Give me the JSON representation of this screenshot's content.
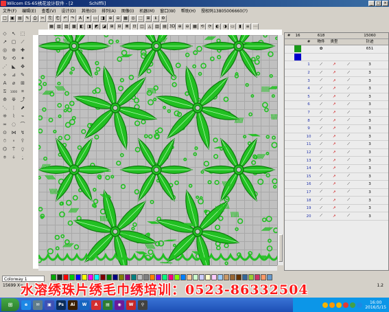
{
  "window": {
    "title": "Wilcom ES-65绣花设计软件 - [2",
    "doc": "Schiffli]",
    "buttons": [
      "_",
      "□",
      "×"
    ]
  },
  "menu": [
    "文件(F)",
    "编辑(E)",
    "查看(V)",
    "设计(D)",
    "其他(O)",
    "排列(A)",
    "图像(I)",
    "机器(M)",
    "窗口(W)",
    "帮助(H)",
    "授权码13805006660(?)"
  ],
  "toolbar1": [
    "□",
    "▣",
    "▤",
    "✎",
    "⎙",
    "✂",
    "⎘",
    "⎗",
    "↶",
    "↷",
    "A",
    "✦",
    "▭",
    "◨",
    "⊕",
    "⊖",
    "▦",
    "◎",
    "⬚",
    "⊞",
    "ℹ",
    "⚙"
  ],
  "toolbar2": [
    "▦",
    "▧",
    "▨",
    "▩",
    "◧",
    "◨",
    "◩",
    "◪",
    "⊞",
    "⊟",
    "⊠",
    "⊡",
    "◫",
    "◬",
    "▥",
    "▤",
    "3D",
    "⊕",
    "⊖",
    "▦",
    "⟲",
    "⟳",
    "◐",
    "◑",
    "▭",
    "▮",
    "≡",
    "⋯"
  ],
  "lefttools": [
    "◇",
    "↖",
    "⬚",
    "↗",
    "▢",
    "⟋",
    "◎",
    "⊕",
    "✚",
    "↻",
    "⟲",
    "✦",
    "⋰",
    "◣",
    "✥",
    "⟡",
    "⊿",
    "✎",
    "A",
    "⌀",
    "⊞",
    "⍂",
    "1000",
    "⌗",
    "⟰",
    "⟱",
    "⤴",
    "⋱",
    "⋮",
    "⬈",
    "⁜",
    "⌇",
    "⌁",
    "∞",
    "◌",
    "⌒",
    "⊙",
    "⋈",
    "↯",
    "⍥",
    "⍤",
    "⍢",
    "⌬",
    "⍡",
    "⍜",
    "⍟",
    "⍭",
    "⍮"
  ],
  "panel": {
    "header": [
      "#",
      "16",
      "",
      "618",
      "",
      "15060"
    ],
    "header2": [
      "",
      "",
      "#",
      "物件",
      "类型",
      "",
      "针迹"
    ],
    "rows": [
      {
        "n": "",
        "color": "#1a9a1a",
        "a": "✿",
        "b": "",
        "c": "",
        "d": "651"
      },
      {
        "n": "",
        "color": "#0000cc",
        "a": "",
        "b": "",
        "c": "",
        "d": ""
      },
      {
        "n": "1",
        "color": "",
        "a": "⟋",
        "b": "↗",
        "c": "⟋",
        "d": "3"
      },
      {
        "n": "2",
        "color": "",
        "a": "⟋",
        "b": "↗",
        "c": "⟋",
        "d": "3"
      },
      {
        "n": "3",
        "color": "",
        "a": "⟋",
        "b": "↗",
        "c": "⟋",
        "d": "3"
      },
      {
        "n": "4",
        "color": "",
        "a": "⟋",
        "b": "↗",
        "c": "⟋",
        "d": "3"
      },
      {
        "n": "5",
        "color": "",
        "a": "⟋",
        "b": "↗",
        "c": "⟋",
        "d": "3"
      },
      {
        "n": "6",
        "color": "",
        "a": "⟋",
        "b": "↗",
        "c": "⟋",
        "d": "3"
      },
      {
        "n": "7",
        "color": "",
        "a": "⟋",
        "b": "↗",
        "c": "⟋",
        "d": "3"
      },
      {
        "n": "8",
        "color": "",
        "a": "⟋",
        "b": "↗",
        "c": "⟋",
        "d": "3"
      },
      {
        "n": "9",
        "color": "",
        "a": "⟋",
        "b": "↗",
        "c": "⟋",
        "d": "3"
      },
      {
        "n": "10",
        "color": "",
        "a": "⟋",
        "b": "↗",
        "c": "⟋",
        "d": "3"
      },
      {
        "n": "11",
        "color": "",
        "a": "⟋",
        "b": "↗",
        "c": "⟋",
        "d": "3"
      },
      {
        "n": "12",
        "color": "",
        "a": "⟋",
        "b": "↗",
        "c": "⟋",
        "d": "3"
      },
      {
        "n": "13",
        "color": "",
        "a": "⟋",
        "b": "↗",
        "c": "⟋",
        "d": "3"
      },
      {
        "n": "14",
        "color": "",
        "a": "⟋",
        "b": "↗",
        "c": "⟋",
        "d": "3"
      },
      {
        "n": "15",
        "color": "",
        "a": "⟋",
        "b": "↗",
        "c": "⟋",
        "d": "3"
      },
      {
        "n": "16",
        "color": "",
        "a": "⟋",
        "b": "↗",
        "c": "⟋",
        "d": "3"
      },
      {
        "n": "17",
        "color": "",
        "a": "⟋",
        "b": "↗",
        "c": "⟋",
        "d": "3"
      },
      {
        "n": "18",
        "color": "",
        "a": "⟋",
        "b": "↗",
        "c": "⟋",
        "d": "3"
      },
      {
        "n": "19",
        "color": "",
        "a": "⟋",
        "b": "↗",
        "c": "⟋",
        "d": "3"
      },
      {
        "n": "20",
        "color": "",
        "a": "⟋",
        "b": "↗",
        "c": "⟋",
        "d": "3"
      }
    ]
  },
  "colorway": "Colorway 1",
  "palette": [
    "#00aa00",
    "#1e1e1e",
    "#ff0000",
    "#00cc00",
    "#0000ff",
    "#ffff00",
    "#ff00ff",
    "#00ffff",
    "#800000",
    "#008000",
    "#000080",
    "#808000",
    "#800080",
    "#008080",
    "#c0c0c0",
    "#808080",
    "#ff8000",
    "#8000ff",
    "#00ff80",
    "#ff0080",
    "#80ff00",
    "#0080ff",
    "#ffcc99",
    "#ccffcc",
    "#ccccff",
    "#ffffcc",
    "#ffccff",
    "#99ccff",
    "#cc9966",
    "#996633",
    "#663300",
    "#336699",
    "#99cc33",
    "#cc3366",
    "#ff9966",
    "#6699cc"
  ],
  "status": {
    "left": "15699 X=",
    "right": "1.2"
  },
  "overlay": "水溶绣珠片绣毛巾绣培训：0523-86332504",
  "taskbar": {
    "apps": [
      {
        "label": "e",
        "color": "#1e88e5"
      },
      {
        "label": "✉",
        "color": "#607d8b"
      },
      {
        "label": "▣",
        "color": "#3f51b5"
      },
      {
        "label": "Ps",
        "color": "#0b2d5b"
      },
      {
        "label": "Ai",
        "color": "#3b1f00"
      },
      {
        "label": "W",
        "color": "#1565c0"
      },
      {
        "label": "A",
        "color": "#d32f2f"
      },
      {
        "label": "▤",
        "color": "#2e7d32"
      },
      {
        "label": "◉",
        "color": "#6a1b9a"
      },
      {
        "label": "W",
        "color": "#c62828"
      },
      {
        "label": "⚲",
        "color": "#424242"
      }
    ],
    "time": "16:00",
    "date": "2016/5/15",
    "tray": [
      "#f5b400",
      "#ff9800",
      "#f5b400",
      "#e53935",
      "#43a047",
      "#1e88e5"
    ]
  },
  "colors": {
    "stitch_green": "#22c022",
    "stitch_dark": "#0e7a0e"
  }
}
